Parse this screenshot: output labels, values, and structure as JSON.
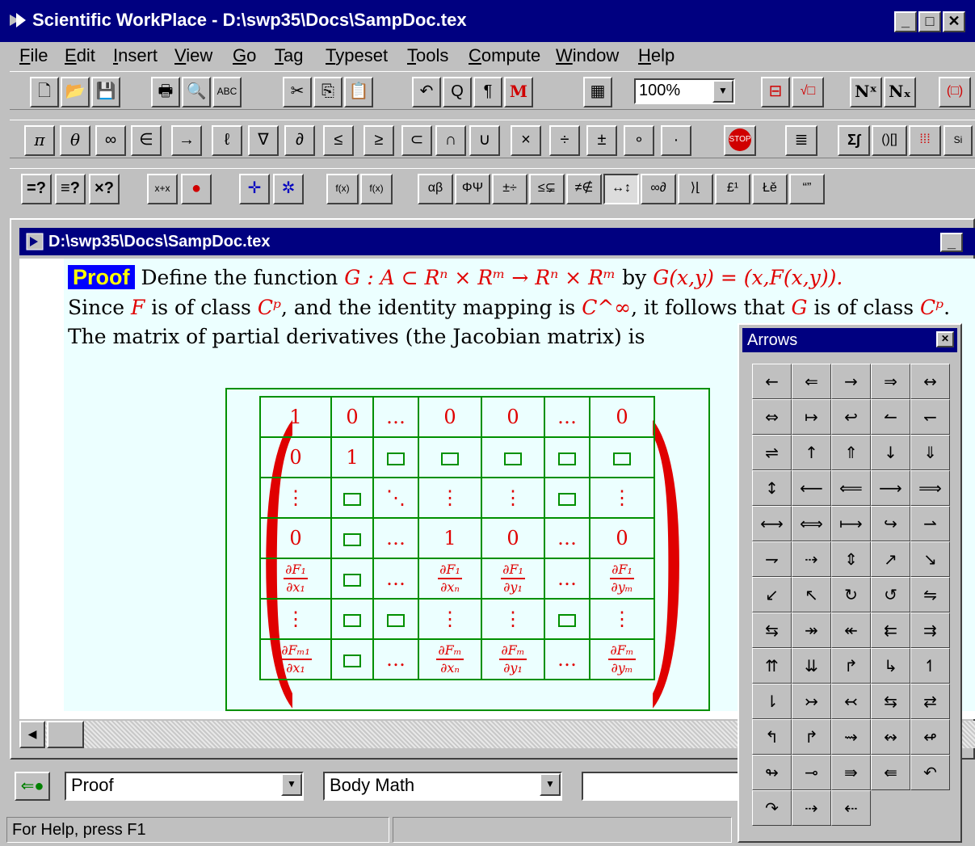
{
  "window": {
    "title": "Scientific WorkPlace - D:\\swp35\\Docs\\SampDoc.tex",
    "min": "_",
    "max": "□",
    "close": "✕"
  },
  "menu": [
    "File",
    "Edit",
    "Insert",
    "View",
    "Go",
    "Tag",
    "Typeset",
    "Tools",
    "Compute",
    "Window",
    "Help"
  ],
  "toolbar1": {
    "buttons": [
      "🗋",
      "📂",
      "💾",
      "🖶",
      "🔍",
      "ABC",
      "✂",
      "⎘",
      "📋",
      "↶",
      "Q",
      "¶",
      "M",
      "▦"
    ],
    "zoom": "100%",
    "right": [
      "⊟",
      "√□",
      "Nˣ",
      "Nₓ",
      "(□)"
    ]
  },
  "toolbar2": {
    "buttons": [
      "π",
      "θ",
      "∞",
      "∈",
      "→",
      "ℓ",
      "∇",
      "∂",
      "≤",
      "≥",
      "⊂",
      "∩",
      "∪",
      "×",
      "÷",
      "±",
      "∘",
      "·"
    ],
    "right": [
      "STOP",
      "≣",
      "Σ∫",
      "()[]",
      "⁞⁞⁞",
      "Si"
    ]
  },
  "toolbar3": {
    "buttons": [
      "=?",
      "≡?",
      "×?",
      "x+x",
      "●",
      "✛",
      "✲",
      "f(x)",
      "f(x)"
    ],
    "symbols": [
      "αβ",
      "ΦΨ",
      "±÷",
      "≤⊊",
      "≠∉",
      "↔↕",
      "∞∂",
      "⟩⌊",
      "£¹",
      "Łě",
      "“”"
    ]
  },
  "document": {
    "title": "D:\\swp35\\Docs\\SampDoc.tex",
    "proof_label": "Proof",
    "line1_text": " Define the function ",
    "line1_math": "G : A ⊂ Rⁿ × Rᵐ → Rⁿ × Rᵐ",
    "line1_by": " by ",
    "line1_math2": "G(x,y) = (x,F(x,y)).",
    "line2_a": "Since ",
    "line2_F": "F",
    "line2_b": " is of class ",
    "line2_Cp": "Cᵖ",
    "line2_c": ", and the identity mapping is ",
    "line2_Cinf": "C^∞",
    "line2_d": ", it follows that ",
    "line2_G": "G",
    "line2_e": " is of class ",
    "line2_Cp2": "Cᵖ",
    "line2_f": ".",
    "line3": "The matrix of partial derivatives (the Jacobian matrix) is"
  },
  "matrix": [
    [
      "1",
      "0",
      "…",
      "0",
      "0",
      "…",
      "0"
    ],
    [
      "0",
      "1",
      "□",
      "□",
      "□",
      "□",
      "□"
    ],
    [
      "⋮",
      "□",
      "⋱",
      "⋮",
      "⋮",
      "□",
      "⋮"
    ],
    [
      "0",
      "□",
      "…",
      "1",
      "0",
      "…",
      "0"
    ],
    [
      [
        "∂F₁",
        "∂x₁"
      ],
      "□",
      "…",
      [
        "∂F₁",
        "∂xₙ"
      ],
      [
        "∂F₁",
        "∂y₁"
      ],
      "…",
      [
        "∂F₁",
        "∂yₘ"
      ]
    ],
    [
      "⋮",
      "□",
      "□",
      "⋮",
      "⋮",
      "□",
      "⋮"
    ],
    [
      [
        "∂Fₘ₁",
        "∂x₁"
      ],
      "□",
      "…",
      [
        "∂Fₘ",
        "∂xₙ"
      ],
      [
        "∂Fₘ",
        "∂y₁"
      ],
      "…",
      [
        "∂Fₘ",
        "∂yₘ"
      ]
    ]
  ],
  "bottom": {
    "tag": "Proof",
    "style": "Body Math",
    "field3": ""
  },
  "status": {
    "help": "For Help, press F1"
  },
  "arrows_panel": {
    "title": "Arrows",
    "symbols": [
      "←",
      "⇐",
      "→",
      "⇒",
      "↔",
      "⇔",
      "↦",
      "↩",
      "↼",
      "↽",
      "⇌",
      "↑",
      "⇑",
      "↓",
      "⇓",
      "↕",
      "⟵",
      "⟸",
      "⟶",
      "⟹",
      "⟷",
      "⟺",
      "⟼",
      "↪",
      "⇀",
      "⇁",
      "⇢",
      "⇕",
      "↗",
      "↘",
      "↙",
      "↖",
      "↻",
      "↺",
      "⇋",
      "⇆",
      "↠",
      "↞",
      "⇇",
      "⇉",
      "⇈",
      "⇊",
      "↱",
      "↳",
      "↿",
      "⇂",
      "↣",
      "↢",
      "⇆",
      "⇄",
      "↰",
      "↱",
      "⇝",
      "↭",
      "↫",
      "↬",
      "⊸",
      "⇛",
      "⇚",
      "↶",
      "↷",
      "⇢",
      "⇠"
    ]
  }
}
